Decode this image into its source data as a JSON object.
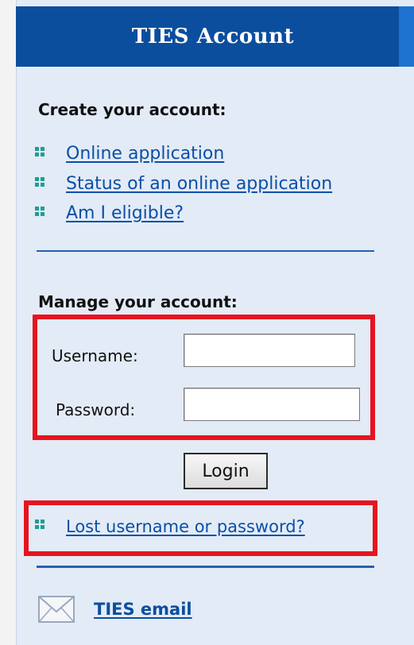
{
  "header": {
    "title": "TIES Account"
  },
  "create_section": {
    "title": "Create your account:",
    "links": [
      {
        "label": "Online application"
      },
      {
        "label": "Status of an online application"
      },
      {
        "label": "Am I eligible?"
      }
    ]
  },
  "manage_section": {
    "title": "Manage your account:",
    "username_label": "Username:",
    "username_value": "",
    "password_label": "Password:",
    "password_value": "",
    "login_label": "Login",
    "lost_link": "Lost username or password?"
  },
  "footer": {
    "email_link": "TIES email",
    "email_icon": "envelope-icon"
  },
  "colors": {
    "header_bg": "#0b4e9e",
    "panel_bg": "#e3ebf6",
    "link": "#0b4fa7",
    "bullet": "#1d9f92",
    "highlight": "#e6141f"
  }
}
